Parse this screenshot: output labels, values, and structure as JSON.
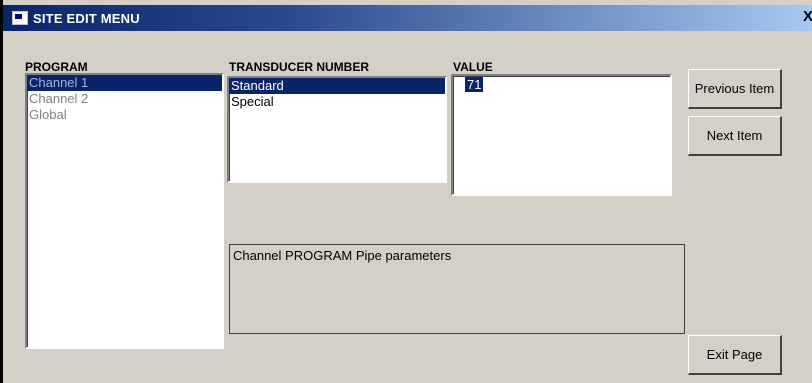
{
  "window": {
    "title": "SITE EDIT MENU",
    "close_glyph": "X"
  },
  "program": {
    "label": "PROGRAM",
    "items": [
      {
        "text": "Channel 1",
        "selected": true
      },
      {
        "text": "Channel 2",
        "selected": false
      },
      {
        "text": "Global",
        "selected": false
      }
    ]
  },
  "transducer": {
    "label": "TRANSDUCER NUMBER",
    "items": [
      {
        "text": "Standard",
        "selected": true
      },
      {
        "text": "Special",
        "selected": false
      }
    ]
  },
  "value": {
    "label": "VALUE",
    "current": "71"
  },
  "description": {
    "text": "Channel PROGRAM   Pipe parameters"
  },
  "buttons": {
    "previous": "Previous Item",
    "next": "Next Item",
    "exit": "Exit Page"
  },
  "colors": {
    "selection": "#0a246a",
    "face": "#d4d0c8"
  }
}
